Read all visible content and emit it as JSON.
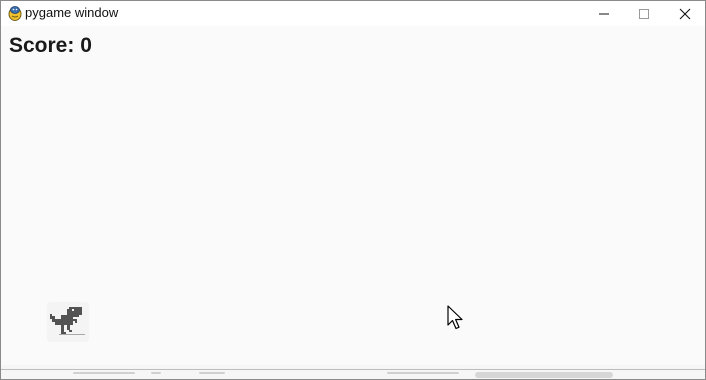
{
  "window": {
    "title": "pygame window",
    "icon": "pygame-snake-icon",
    "controls": {
      "minimize_icon": "minimize-icon",
      "maximize_icon": "maximize-icon",
      "close_icon": "close-icon"
    }
  },
  "game": {
    "score_text": "Score: 0",
    "player_sprite": "dino-icon",
    "pointer": "mouse-pointer-icon",
    "colors": {
      "background": "#fafafa",
      "text": "#1a1a1a",
      "dino": "#535353"
    }
  }
}
